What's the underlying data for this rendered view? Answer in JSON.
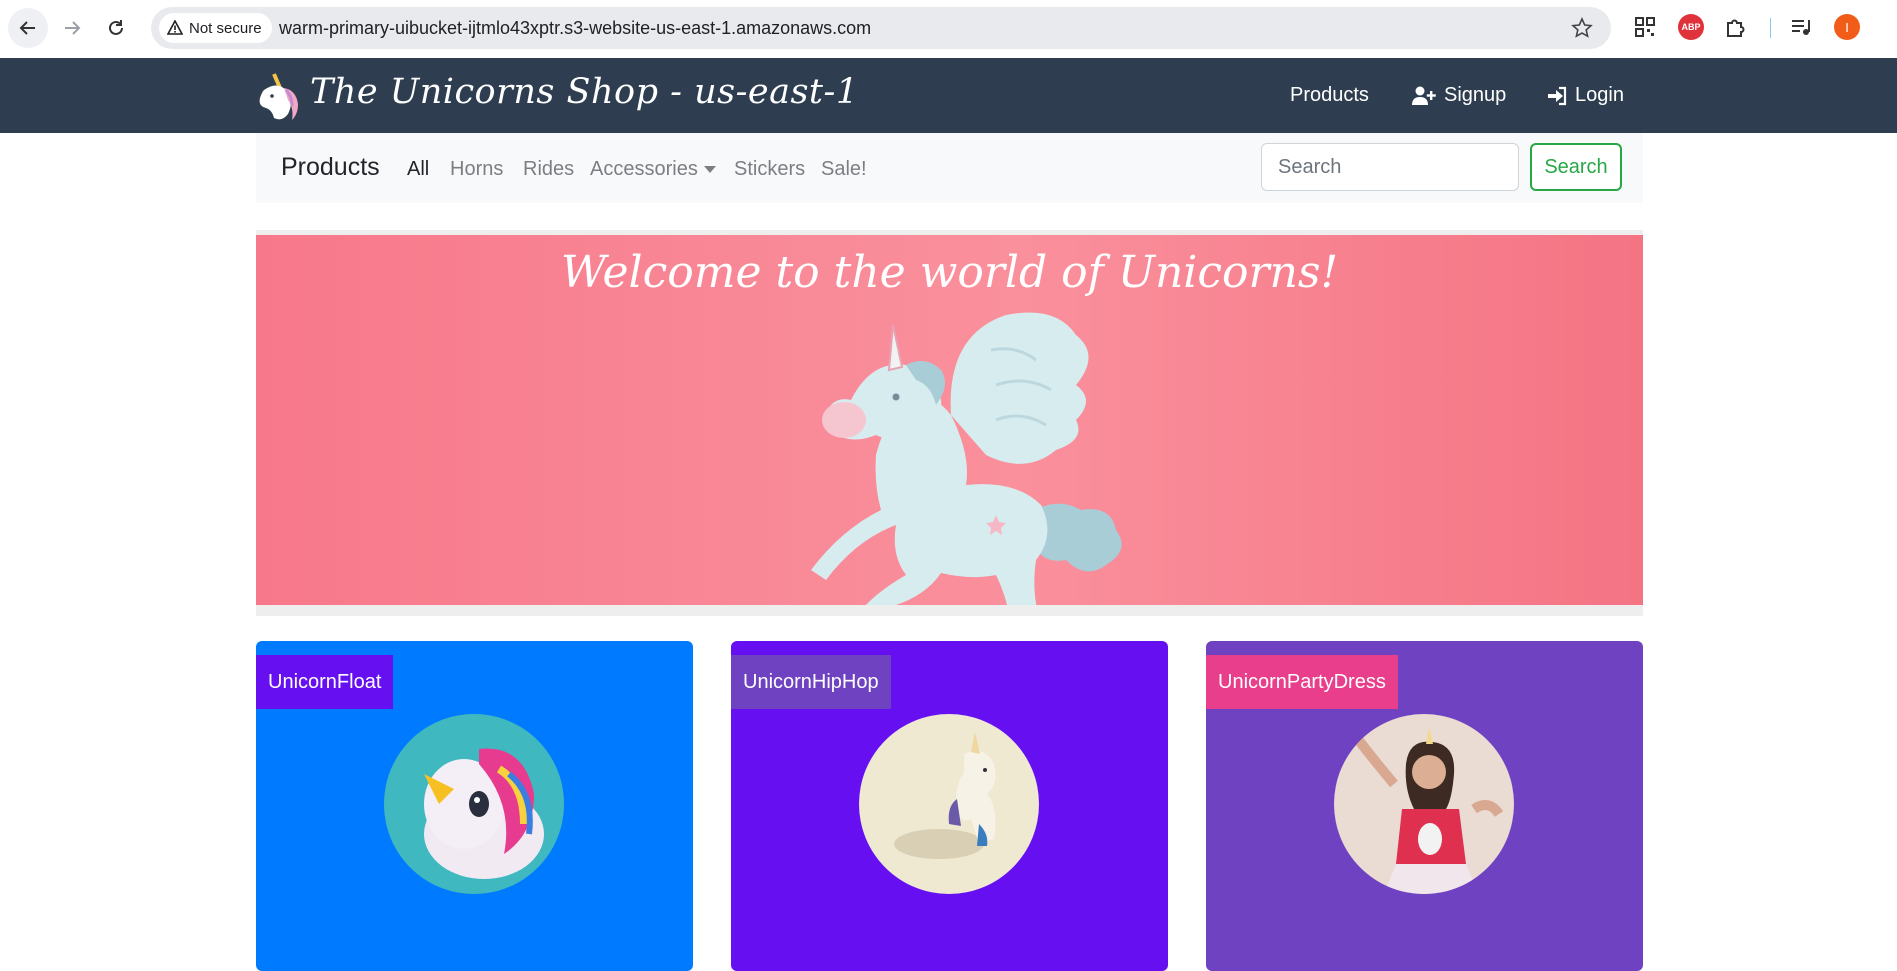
{
  "browser": {
    "security_label": "Not secure",
    "url": "warm-primary-uibucket-ijtmlo43xptr.s3-website-us-east-1.amazonaws.com",
    "extensions": [
      "qr-code-icon",
      "adblock-plus-icon",
      "puzzle-extensions-icon",
      "media-queue-icon"
    ],
    "abp_label": "ABP",
    "profile_initial": "I"
  },
  "site": {
    "brand": "The Unicorns Shop - us-east-1",
    "nav": {
      "products": "Products",
      "signup": "Signup",
      "login": "Login"
    }
  },
  "subnav": {
    "brand": "Products",
    "categories": [
      "All",
      "Horns",
      "Rides",
      "Accessories",
      "Stickers",
      "Sale!"
    ],
    "active_category": "All",
    "search_placeholder": "Search",
    "search_button": "Search"
  },
  "banner": {
    "title": "Welcome to the world of Unicorns!"
  },
  "cards": [
    {
      "name": "UnicornFloat",
      "bg": "#007bff",
      "label_bg": "#6610f2"
    },
    {
      "name": "UnicornHipHop",
      "bg": "#6610f2",
      "label_bg": "#6f42c1"
    },
    {
      "name": "UnicornPartyDress",
      "bg": "#6f42c1",
      "label_bg": "#e83e8c"
    }
  ]
}
